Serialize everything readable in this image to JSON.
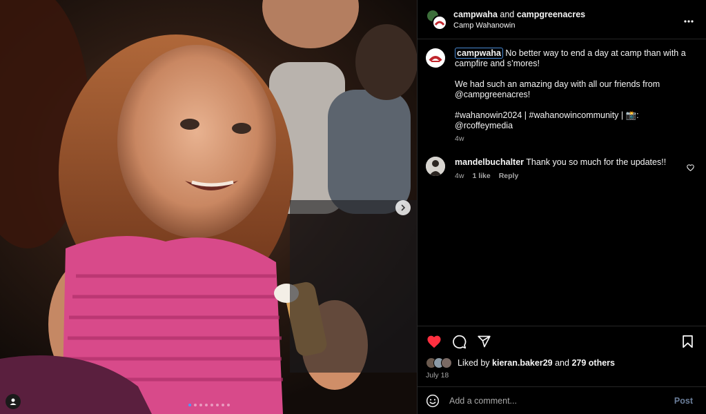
{
  "header": {
    "author": "campwaha",
    "joiner": "and",
    "collaborator": "campgreenacres",
    "location": "Camp Wahanowin"
  },
  "media": {
    "dots_total": 8,
    "active_dot": 1
  },
  "caption": {
    "username": "campwaha",
    "line1": "No better way to end a day at camp than with a campfire and s’mores!",
    "line2": "We had such an amazing day with all our friends from @campgreenacres!",
    "line3a": "#wahanowin2024 | #wahanowincommunity | 📸:",
    "line3b": "@rcoffeymedia",
    "time": "4w"
  },
  "comment": {
    "username": "mandelbuchalter",
    "text": "Thank you so much for the updates!!",
    "time": "4w",
    "likes": "1 like",
    "reply": "Reply"
  },
  "likes": {
    "prefix": "Liked by",
    "user": "kieran.baker29",
    "joiner": "and",
    "others": "279 others"
  },
  "date": "July 18",
  "add_comment": {
    "placeholder": "Add a comment...",
    "post_label": "Post"
  },
  "colors": {
    "like_red": "#ff3040",
    "link_blue": "#4a8bd6",
    "muted": "#a8a8a8"
  }
}
